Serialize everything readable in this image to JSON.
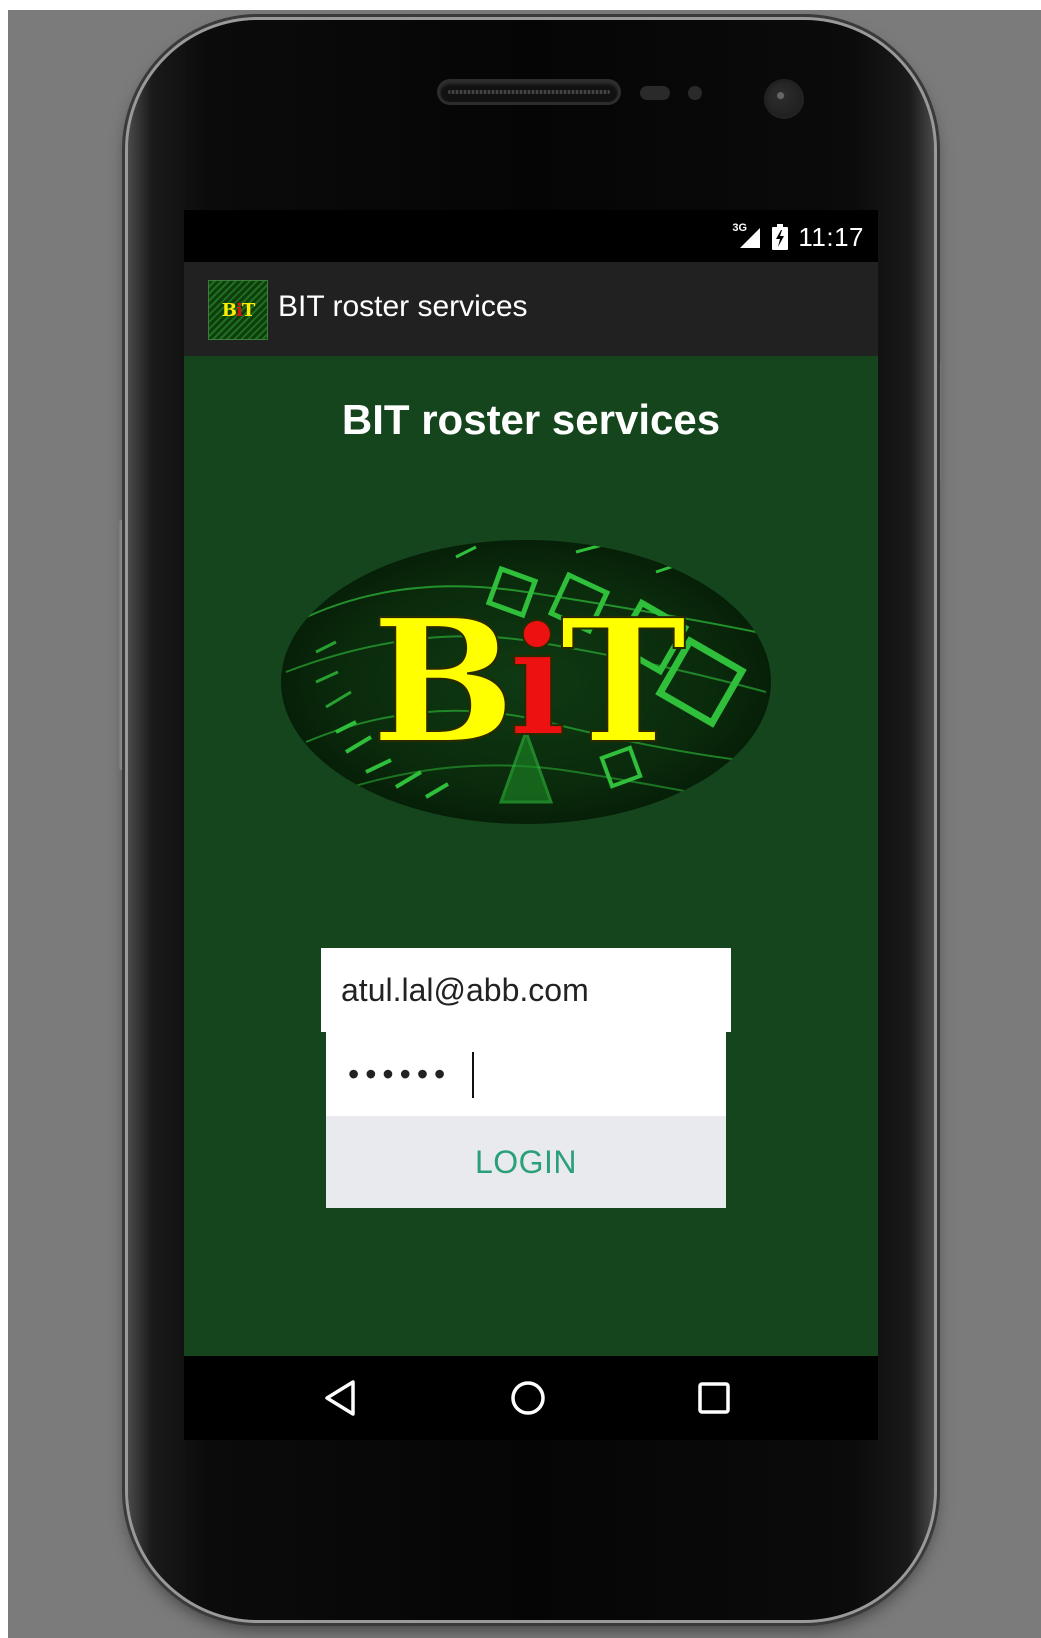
{
  "status_bar": {
    "network": "3G",
    "time": "11:17",
    "icons": [
      "signal-icon",
      "battery-charging-icon"
    ]
  },
  "action_bar": {
    "app_icon_text": {
      "part1": "B",
      "part2": "i",
      "part3": "T"
    },
    "title": "BIT roster services"
  },
  "main": {
    "title": "BIT roster services",
    "logo_text": {
      "part1": "B",
      "part2": "i",
      "part3": "T"
    },
    "login": {
      "email_value": "atul.lal@abb.com",
      "password_value": "••••••",
      "login_button": "LOGIN"
    }
  },
  "nav_bar": {
    "back": "back-icon",
    "home": "home-icon",
    "recents": "recents-icon"
  },
  "colors": {
    "background": "#7b7b7b",
    "action_bar": "#212121",
    "content": "#14451c",
    "login_button_text": "#2aa07a",
    "logo_yellow": "#ffff00",
    "logo_red": "#ee1111"
  }
}
